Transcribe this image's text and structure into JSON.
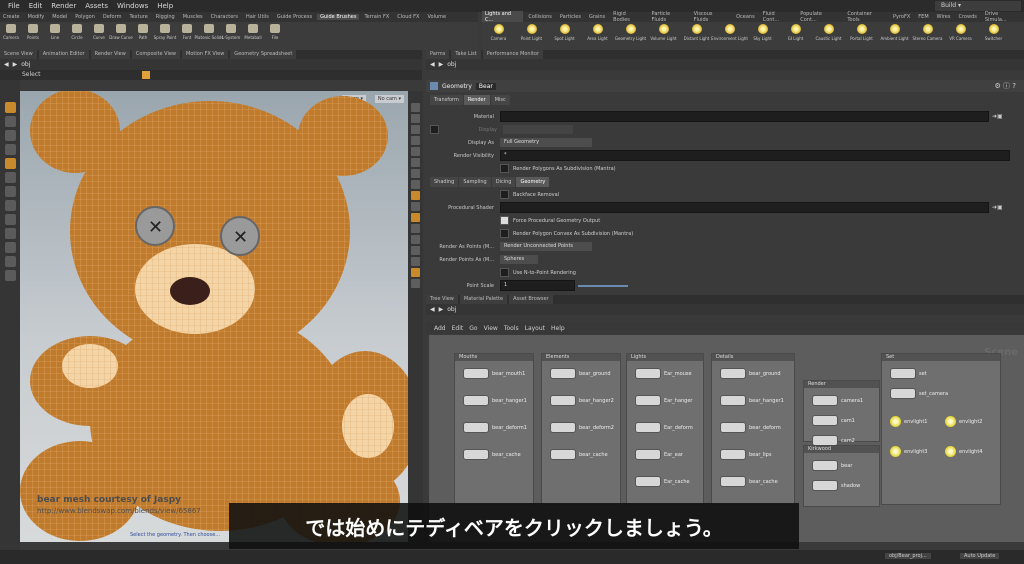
{
  "menu": [
    "File",
    "Edit",
    "Render",
    "Assets",
    "Windows",
    "Help"
  ],
  "shelf_tabs_left": [
    "Create",
    "Modify",
    "Model",
    "Polygon",
    "Deform",
    "Texture",
    "Rigging",
    "Muscles",
    "Characters",
    "Hair Utils",
    "Guide Process",
    "Guide Brushes",
    "Terrain FX",
    "Cloud FX",
    "Volume"
  ],
  "shelf_tabs_right": [
    "Lights and C...",
    "Collisions",
    "Particles",
    "Grains",
    "Rigid Bodies",
    "Particle Fluids",
    "Viscous Fluids",
    "Oceans",
    "Fluid Cont...",
    "Populate Cont...",
    "Container Tools",
    "PyroFX",
    "FEM",
    "Wires",
    "Crowds",
    "Drive Simula..."
  ],
  "shelf_tools_left": [
    "Camera",
    "Points",
    "Line",
    "Circle",
    "Curve",
    "Draw Curve",
    "Path",
    "Spray Paint",
    "Font",
    "Platonic Solids",
    "L-System",
    "Metaball",
    "File"
  ],
  "shelf_tools_right": [
    "Camera",
    "Point Light",
    "Spot Light",
    "Area Light",
    "Geometry Light",
    "Volume Light",
    "Distant Light",
    "Environment Light",
    "Sky Light",
    "GI Light",
    "Caustic Light",
    "Portal Light",
    "Ambient Light",
    "Stereo Camera",
    "VR Camera",
    "Switcher"
  ],
  "desktop": "Build",
  "left_tabs": [
    "Scene View",
    "Animation Editor",
    "Render View",
    "Composite View",
    "Motion FX View",
    "Geometry Spreadsheet"
  ],
  "right_top_tabs": [
    "Tree View",
    "Material Palette",
    "Asset Browser"
  ],
  "props_tabs": [
    "Parms",
    "Take List",
    "Performance Monitor"
  ],
  "path": "obj",
  "viewport": {
    "tool": "Select",
    "persp": "Persp ▾",
    "cam": "No cam ▾",
    "credit_line1": "bear mesh courtesy of Jaspy",
    "credit_line2": "http://www.blendswap.com/blends/view/65867",
    "hint": "Select the geometry. Then choose..."
  },
  "params": {
    "node_type": "Geometry",
    "node_name": "Bear",
    "tabs": [
      "Transform",
      "Render",
      "Misc"
    ],
    "material_label": "Material",
    "display_label": "Display",
    "display_as_label": "Display As",
    "display_as_value": "Full Geometry",
    "render_vis_label": "Render Visibility",
    "render_vis_value": "*",
    "render_poly_subdiv": "Render Polygons As Subdivision (Mantra)",
    "sub_tabs": [
      "Shading",
      "Sampling",
      "Dicing",
      "Geometry"
    ],
    "backface": "Backface Removal",
    "procedural_label": "Procedural Shader",
    "force_proc": "Force Procedural Geometry Output",
    "render_convex": "Render Polygon Convex As Subdivision (Mantra)",
    "render_as_points_label": "Render As Points (M...",
    "render_as_points_value": "Render Unconnected Points",
    "render_pts_label": "Render Points As (M...",
    "render_pts_value": "Spheres",
    "nurbs_note": "Use N-to-Point Rendering",
    "point_scale_label": "Point Scale",
    "point_scale_value": "1"
  },
  "network": {
    "path": "obj",
    "menu": [
      "Add",
      "Edit",
      "Go",
      "View",
      "Tools",
      "Layout",
      "Help"
    ],
    "watermark": "Scene",
    "boxes": [
      {
        "title": "Mouths",
        "nodes": [
          "bear_mouth1",
          "bear_hanger1",
          "bear_deform1",
          "bear_cache"
        ]
      },
      {
        "title": "Elements",
        "nodes": [
          "bear_ground",
          "bear_hanger2",
          "bear_deform2",
          "bear_cache"
        ]
      },
      {
        "title": "Lights",
        "nodes": [
          "Ear_mouse",
          "Ear_hanger",
          "Ear_deform",
          "Ear_ear",
          "Ear_cache"
        ]
      },
      {
        "title": "Details",
        "nodes": [
          "bear_ground",
          "bear_hanger1",
          "bear_deform",
          "bear_lips",
          "bear_cache"
        ]
      },
      {
        "title": "Render",
        "nodes": [
          "camera1",
          "cam1",
          "cam2"
        ]
      },
      {
        "title": "Kirkwood",
        "nodes": [
          "bear",
          "shadow"
        ]
      },
      {
        "title": "Set",
        "nodes": [
          "set",
          "set_camera",
          "envlight1",
          "envlight2",
          "envlight3",
          "envlight4"
        ]
      }
    ]
  },
  "subtitle": "では始めにテディベアをクリックしましょう。",
  "status": {
    "file": "obj/Bear_proj...",
    "update": "Auto Update"
  }
}
